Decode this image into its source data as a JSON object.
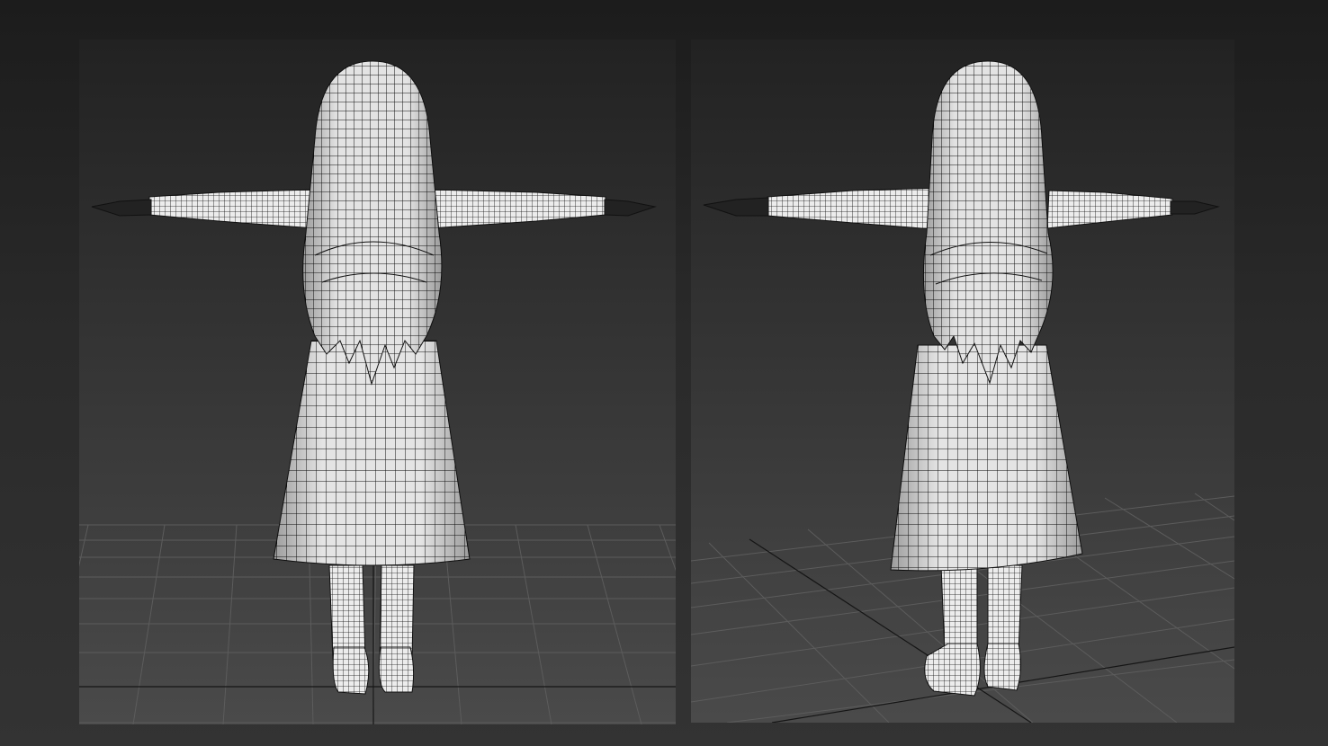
{
  "viewports": [
    {
      "id": "left",
      "view": "back-orthographic",
      "grid": "on"
    },
    {
      "id": "right",
      "view": "back-perspective",
      "grid": "on"
    }
  ],
  "render": {
    "mode": "wireframe-on-shaded",
    "mesh_color": "#f2f2f2",
    "wire_color": "#111111"
  },
  "colors": {
    "background_top": "#1c1c1c",
    "background_bottom": "#333333",
    "viewport_bg_top": "#222222",
    "viewport_bg_bottom": "#4a4a4a",
    "grid_line": "#5a5a5a",
    "axis_line": "#1a1a1a"
  }
}
